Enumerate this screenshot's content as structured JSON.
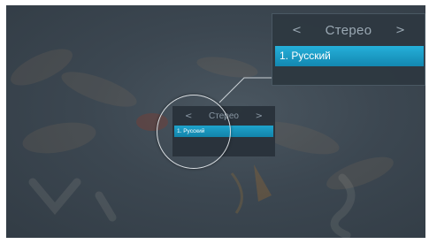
{
  "popup": {
    "prev_icon": "chevron-left-icon",
    "next_icon": "chevron-right-icon",
    "prev_glyph": "<",
    "next_glyph": ">",
    "title": "Стерео",
    "selected_item": "1. Русский"
  },
  "small_menu": {
    "prev_glyph": "<",
    "next_glyph": ">",
    "title": "Стерео",
    "selected_item": "1. Русский"
  },
  "colors": {
    "selection": "#1ea3cc",
    "panel": "#2e3841",
    "background": "#3a4550"
  }
}
